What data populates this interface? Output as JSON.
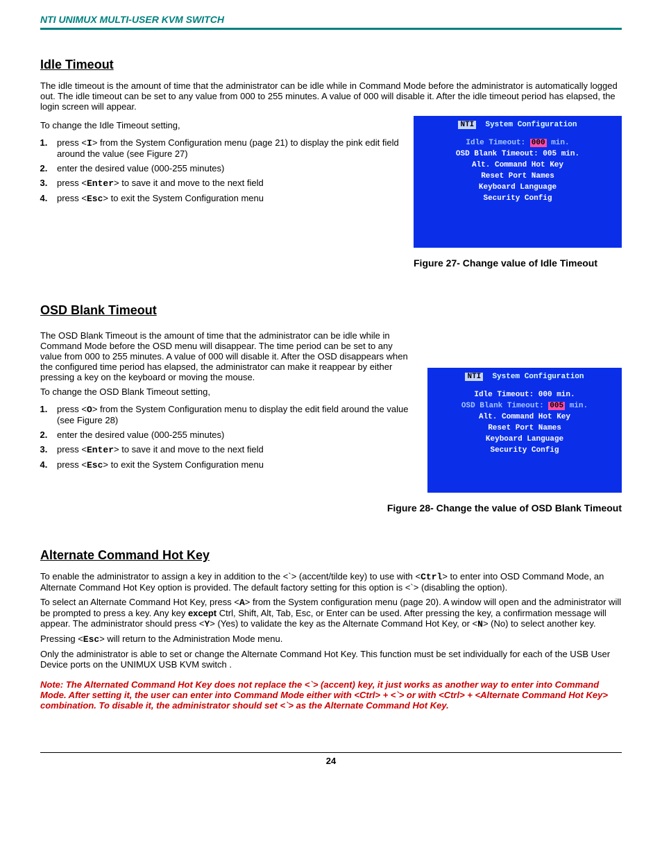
{
  "header": {
    "title": "NTI UNIMUX MULTI-USER KVM SWITCH"
  },
  "idle": {
    "heading": "Idle Timeout",
    "para": "The idle timeout is the amount of time that the administrator can be idle while in Command Mode before the administrator is automatically logged out.    The idle timeout can be set to any value from 000 to 255 minutes.   A value of 000 will disable it.   After the idle timeout period has elapsed, the login screen will appear.",
    "lead": "To change the Idle Timeout setting,",
    "steps": {
      "s1a": "press <",
      "s1k": "I",
      "s1b": "> from the System Configuration menu (page 21) to display the pink edit field around the value (see Figure 27)",
      "s2": "enter the desired value (000-255 minutes)",
      "s3a": "press <",
      "s3k": "Enter",
      "s3b": "> to save it and move to the next field",
      "s4a": "press <",
      "s4k": "Esc",
      "s4b": "> to exit the System Configuration menu"
    },
    "caption": "Figure 27- Change value of Idle Timeout"
  },
  "osd": {
    "heading": "OSD Blank Timeout",
    "para": "The OSD Blank Timeout is the amount of time that the administrator can be idle while in Command Mode before the OSD menu will disappear.   The time period can be set to any value from 000 to 255 minutes.   A value of 000 will disable it.   After the OSD disappears when the configured time period has elapsed, the administrator can make it reappear by either pressing a key on the keyboard or moving the mouse.",
    "lead": "To change the OSD Blank Timeout setting,",
    "steps": {
      "s1a": "press <",
      "s1k": "O",
      "s1b": "> from the System Configuration menu to display the  edit field around the value (see Figure 28)",
      "s2": "enter the desired value (000-255 minutes)",
      "s3a": "press <",
      "s3k": "Enter",
      "s3b": "> to save it and move to the next field",
      "s4a": "press <",
      "s4k": "Esc",
      "s4b": "> to exit the System Configuration menu"
    },
    "caption": "Figure 28- Change the value of OSD Blank Timeout"
  },
  "alt": {
    "heading": "Alternate Command Hot Key",
    "p1a": "To enable the administrator to assign a key in addition to the <`> (accent/tilde key) to use with <",
    "p1k": "Ctrl",
    "p1b": "> to enter into OSD Command Mode, an Alternate Command Hot Key option is provided.  The default factory setting for this option is <`> (disabling the option).",
    "p2a": "To select an Alternate Command Hot Key, press <",
    "p2k": "A",
    "p2b": "> from the System configuration menu (page 20).  A window will open and the administrator will be prompted to press a key. Any key ",
    "p2except": "except",
    "p2c": " Ctrl, Shift, Alt, Tab, Esc, or Enter can be used.   After pressing the key, a confirmation message will appear.  The administrator should press <",
    "p2k2": "Y",
    "p2d": "> (Yes) to validate the key as the Alternate Command Hot Key, or <",
    "p2k3": "N",
    "p2e": "> (No) to select another key.",
    "p3a": "Pressing <",
    "p3k": "Esc",
    "p3b": "> will return to the Administration Mode menu.",
    "p4": "Only the administrator is able to set or change the Alternate Command Hot Key. This function must be set individually for each of the USB User Device ports on the UNIMUX USB KVM switch .",
    "note": "Note: The Alternated Command Hot Key does not replace the <`> (accent) key, it just works as another way to enter into Command Mode. After setting it, the user can enter into Command Mode either with <Ctrl> + <`> or with <Ctrl> + <Alternate Command Hot Key> combination. To disable it, the administrator should set <`> as the Alternate Command Hot Key."
  },
  "osd_screens": {
    "title": "System Configuration",
    "brand": "NTI",
    "fig27": {
      "idle_label": "Idle Timeout: ",
      "idle_hi": "000",
      "idle_suffix": " min.",
      "osd": "OSD Blank Timeout: 005 min.",
      "alt": "Alt. Command Hot Key",
      "reset": "Reset Port Names",
      "kb": "Keyboard Language",
      "sec": "Security Config"
    },
    "fig28": {
      "idle": "Idle Timeout: 000 min.",
      "osd_label": "OSD Blank Timeout: ",
      "osd_hi": "005",
      "osd_suffix": " min.",
      "alt": "Alt. Command Hot Key",
      "reset": "Reset Port Names",
      "kb": "Keyboard Language",
      "sec": "Security Config"
    }
  },
  "footer": {
    "page": "24"
  }
}
